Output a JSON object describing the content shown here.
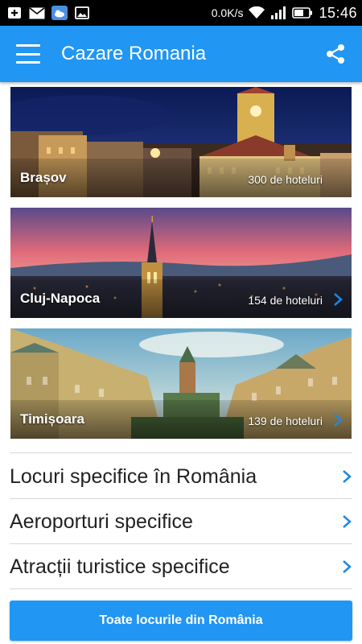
{
  "status_bar": {
    "speed": "0.0K/s",
    "time": "15:46",
    "icons": [
      "add-notification-icon",
      "mail-icon",
      "weather-icon",
      "image-icon",
      "wifi-icon",
      "signal-icon",
      "battery-icon"
    ]
  },
  "app_bar": {
    "title": "Cazare Romania",
    "menu_icon": "hamburger-menu-icon",
    "share_icon": "share-icon"
  },
  "cities": [
    {
      "name": "Brașov",
      "count": "300 de hoteluri"
    },
    {
      "name": "Cluj-Napoca",
      "count": "154 de hoteluri"
    },
    {
      "name": "Timișoara",
      "count": "139 de hoteluri"
    }
  ],
  "links": [
    {
      "label": "Locuri specifice în România"
    },
    {
      "label": "Aeroporturi specifice"
    },
    {
      "label": "Atracții turistice specifice"
    }
  ],
  "cta": {
    "label": "Toate locurile din România"
  },
  "colors": {
    "primary": "#2196F3",
    "chevron": "#1E88E5"
  }
}
